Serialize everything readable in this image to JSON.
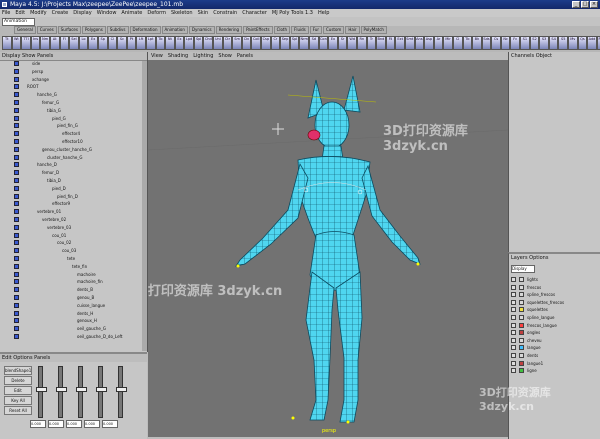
{
  "window": {
    "title": "Maya 4.5: J:\\Projects Max\\zeepee\\ZeePee\\zeepee_101.mb"
  },
  "menubar": [
    "File",
    "Edit",
    "Modify",
    "Create",
    "Display",
    "Window",
    "Animate",
    "Deform",
    "Skeleton",
    "Skin",
    "Constrain",
    "Character",
    "MJ Poly Tools 1.3",
    "Help"
  ],
  "mode": "Animation",
  "shelf_tabs": [
    "General",
    "Curves",
    "Surfaces",
    "Polygons",
    "Subdivs",
    "Deformation",
    "Animation",
    "Dynamics",
    "Rendering",
    "PaintEffects",
    "Cloth",
    "Fluids",
    "Fur",
    "Custom",
    "Hair",
    "PolyMatch"
  ],
  "shelf_icons": [
    "Tt",
    "Wt",
    "TTI",
    "Ins",
    "Nm",
    "At",
    "Fl",
    "Sel",
    "Lo",
    "Ex",
    "Sp",
    "Cl",
    "Sc",
    "Pt",
    "Lft",
    "Lpt",
    "Tb",
    "Nt",
    "Ex",
    "Lpd",
    "Spl",
    "Chd",
    "Uni",
    "Ctr",
    "Sm",
    "Dv",
    "Coll",
    "Csp",
    "Cr",
    "Sep",
    "Spl",
    "Nrm",
    "Sd",
    "Con",
    "Ex",
    "Sr",
    "Wd",
    "Rn",
    "Tr",
    "Bnd",
    "Fil",
    "Ext",
    "Smt",
    "Ans",
    "Asp",
    "Ar",
    "Mir",
    "Cl",
    "Tb",
    "Bk",
    "Sds",
    "Cs",
    "Nc",
    "Fc",
    "S1",
    "S2",
    "S3",
    "S4",
    "S5",
    "Mv",
    "Qs",
    "Add",
    "Res",
    "Ch"
  ],
  "outliner": {
    "header": "Display  Show  Panels",
    "items": [
      "side",
      "persp",
      "xchange",
      "ROOT",
      "hanche_G",
      "femur_G",
      "tibia_G",
      "pied_G",
      "pied_fin_G",
      "effector4",
      "effector10",
      "genou_cluster_hanche_G",
      "cluster_hanche_G",
      "hanche_D",
      "femur_D",
      "tibia_D",
      "pied_D",
      "pied_fin_D",
      "effector9",
      "vertebre_01",
      "vertebre_02",
      "vertebre_03",
      "cou_01",
      "cou_02",
      "cou_03",
      "tete",
      "tete_fin",
      "machoire",
      "machoire_fin",
      "dents_B",
      "genou_B",
      "cuisse_langue",
      "dents_H",
      "genoux_H",
      "oeil_gauche_G",
      "oeil_gauche_D_do_Left"
    ]
  },
  "channel_panel": {
    "header": "Edit  Options  Panels",
    "buttons": [
      "blendShape1",
      "Delete",
      "Edit",
      "Key All",
      "Reset All"
    ],
    "values": [
      "0.000",
      "0.000",
      "0.000",
      "0.000",
      "0.000"
    ]
  },
  "viewport": {
    "menu": [
      "View",
      "Shading",
      "Lighting",
      "Show",
      "Panels"
    ],
    "label": "persp"
  },
  "channel_box": {
    "header": "Channels  Object"
  },
  "layers": {
    "header": "Layers  Options",
    "dropdown": "Display",
    "items": [
      {
        "name": "lights",
        "color": "#d8d8d8"
      },
      {
        "name": "frescos",
        "color": "#d8d8d8"
      },
      {
        "name": "spline_frescos",
        "color": "#d8d8d8"
      },
      {
        "name": "squelettes_frescos",
        "color": "#d8d8d8"
      },
      {
        "name": "squelettes",
        "color": "#f0e040"
      },
      {
        "name": "spline_langue",
        "color": "#d8d8d8"
      },
      {
        "name": "frescos_langue",
        "color": "#ff4040"
      },
      {
        "name": "ongles",
        "color": "#c04040"
      },
      {
        "name": "cheveu",
        "color": "#d8d8d8"
      },
      {
        "name": "langue",
        "color": "#40c0ff"
      },
      {
        "name": "dents",
        "color": "#d8d8d8"
      },
      {
        "name": "langue1",
        "color": "#c04040"
      },
      {
        "name": "ligne",
        "color": "#40c040"
      }
    ]
  },
  "watermark": "3D打印资源库 3dzyk.cn",
  "colors": {
    "mesh": "#4fd6f0",
    "wire": "#0a4b60",
    "viewport_bg": "#727272"
  }
}
